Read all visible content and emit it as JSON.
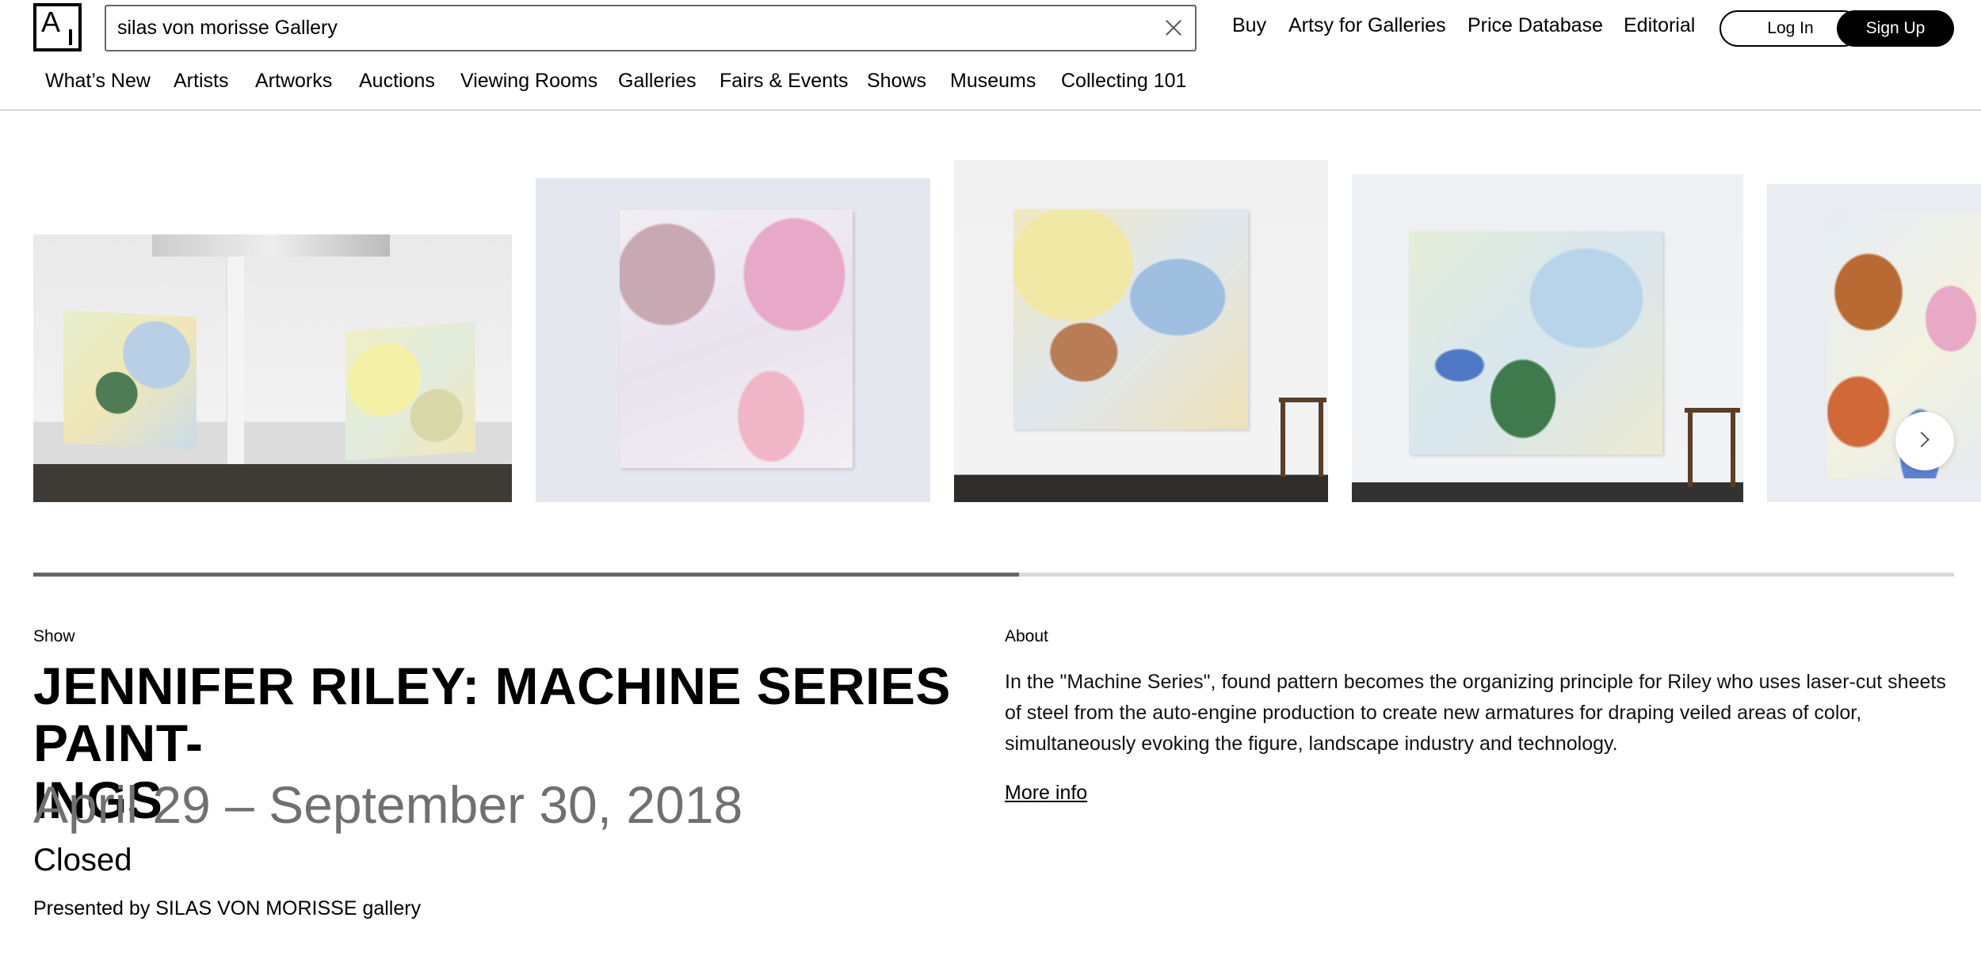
{
  "header": {
    "logo_text": "A",
    "search_value": "silas von morisse Gallery",
    "nav": [
      "Buy",
      "Artsy for Galleries",
      "Price Database",
      "Editorial"
    ],
    "login_label": "Log In",
    "signup_label": "Sign Up"
  },
  "subnav": [
    "What’s New",
    "Artists",
    "Artworks",
    "Auctions",
    "Viewing Rooms",
    "Galleries",
    "Fairs & Events",
    "Shows",
    "Museums",
    "Collecting 101"
  ],
  "carousel": {
    "progress": 0.513
  },
  "show": {
    "kicker": "Show",
    "title": "JENNIFER RILEY: MACHINE SERIES PAINT-INGS",
    "dates": "April 29 – September 30, 2018",
    "status": "Closed",
    "presented_by": "Presented by SILAS VON MORISSE gallery"
  },
  "about": {
    "kicker": "About",
    "text": "In the \"Machine Series\", found pattern becomes the organizing principle for Riley who uses laser-cut sheets of steel from the auto-engine production to create new armatures for draping veiled areas of color, simultaneously evoking the figure, landscape industry and technology.",
    "more_info": "More info"
  }
}
